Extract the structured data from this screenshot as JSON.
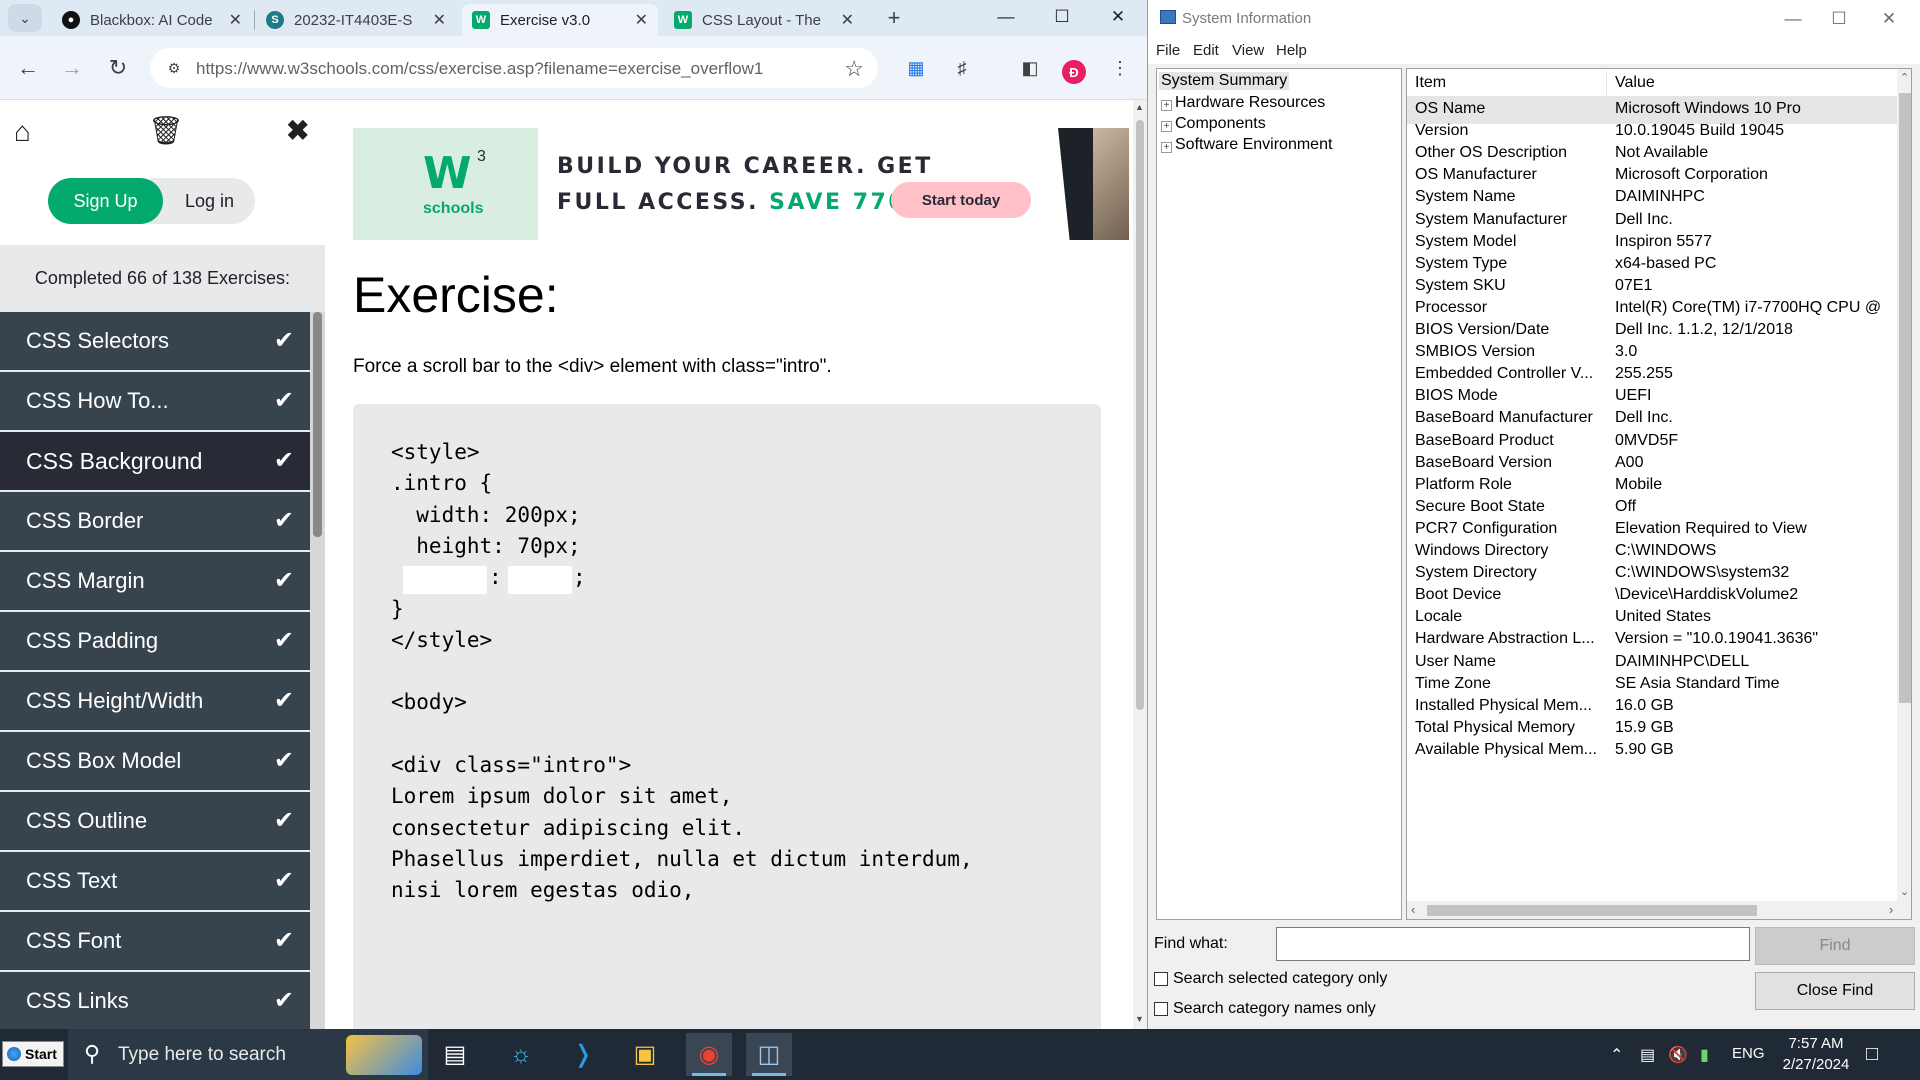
{
  "chrome": {
    "tabs": [
      {
        "title": "Blackbox: AI Code",
        "favicon": "blackbox-icon",
        "active": false
      },
      {
        "title": "20232-IT4403E-S",
        "favicon": "scribd-icon",
        "active": false
      },
      {
        "title": "Exercise v3.0",
        "favicon": "w3schools-icon",
        "active": true
      },
      {
        "title": "CSS Layout - The",
        "favicon": "w3schools-icon",
        "active": false
      }
    ],
    "url": "https://www.w3schools.com/css/exercise.asp?filename=exercise_overflow1",
    "profile_initial": "Đ"
  },
  "w3": {
    "signup_label": "Sign Up",
    "login_label": "Log in",
    "completed_text": "Completed 66 of 138 Exercises:",
    "exercises": [
      {
        "label": "CSS Selectors",
        "done": true
      },
      {
        "label": "CSS How To...",
        "done": true
      },
      {
        "label": "CSS Background",
        "done": true,
        "current": true
      },
      {
        "label": "CSS Border",
        "done": true
      },
      {
        "label": "CSS Margin",
        "done": true
      },
      {
        "label": "CSS Padding",
        "done": true
      },
      {
        "label": "CSS Height/Width",
        "done": true
      },
      {
        "label": "CSS Box Model",
        "done": true
      },
      {
        "label": "CSS Outline",
        "done": true
      },
      {
        "label": "CSS Text",
        "done": true
      },
      {
        "label": "CSS Font",
        "done": true
      },
      {
        "label": "CSS Links",
        "done": true
      }
    ],
    "ad": {
      "logo_text": "W",
      "logo_sup": "3",
      "logo_sub": "schools",
      "line1": "BUILD YOUR CAREER. GET",
      "line2_prefix": "FULL ACCESS. ",
      "line2_highlight": "SAVE 770$",
      "button": "Start today"
    },
    "title": "Exercise:",
    "description": "Force a scroll bar to the <div> element with class=\"intro\".",
    "code_lines": [
      "<style>",
      ".intro {",
      "  width: 200px;",
      "  height: 70px;",
      "__BLANKS__",
      "}",
      "</style>",
      "",
      "<body>",
      "",
      "<div class=\"intro\">",
      "Lorem ipsum dolor sit amet,",
      "consectetur adipiscing elit.",
      "Phasellus imperdiet, nulla et dictum interdum,",
      "nisi lorem egestas odio,"
    ],
    "blank_separator": ":",
    "blank_terminator": ";"
  },
  "sysinfo": {
    "title": "System Information",
    "menu": [
      "File",
      "Edit",
      "View",
      "Help"
    ],
    "tree": [
      "System Summary",
      "Hardware Resources",
      "Components",
      "Software Environment"
    ],
    "columns": [
      "Item",
      "Value"
    ],
    "rows": [
      [
        "OS Name",
        "Microsoft Windows 10 Pro"
      ],
      [
        "Version",
        "10.0.19045 Build 19045"
      ],
      [
        "Other OS Description",
        "Not Available"
      ],
      [
        "OS Manufacturer",
        "Microsoft Corporation"
      ],
      [
        "System Name",
        "DAIMINHPC"
      ],
      [
        "System Manufacturer",
        "Dell Inc."
      ],
      [
        "System Model",
        "Inspiron 5577"
      ],
      [
        "System Type",
        "x64-based PC"
      ],
      [
        "System SKU",
        "07E1"
      ],
      [
        "Processor",
        "Intel(R) Core(TM) i7-7700HQ CPU @"
      ],
      [
        "BIOS Version/Date",
        "Dell Inc. 1.1.2, 12/1/2018"
      ],
      [
        "SMBIOS Version",
        "3.0"
      ],
      [
        "Embedded Controller V...",
        "255.255"
      ],
      [
        "BIOS Mode",
        "UEFI"
      ],
      [
        "BaseBoard Manufacturer",
        "Dell Inc."
      ],
      [
        "BaseBoard Product",
        "0MVD5F"
      ],
      [
        "BaseBoard Version",
        "A00"
      ],
      [
        "Platform Role",
        "Mobile"
      ],
      [
        "Secure Boot State",
        "Off"
      ],
      [
        "PCR7 Configuration",
        "Elevation Required to View"
      ],
      [
        "Windows Directory",
        "C:\\WINDOWS"
      ],
      [
        "System Directory",
        "C:\\WINDOWS\\system32"
      ],
      [
        "Boot Device",
        "\\Device\\HarddiskVolume2"
      ],
      [
        "Locale",
        "United States"
      ],
      [
        "Hardware Abstraction L...",
        "Version = \"10.0.19041.3636\""
      ],
      [
        "User Name",
        "DAIMINHPC\\DELL"
      ],
      [
        "Time Zone",
        "SE Asia Standard Time"
      ],
      [
        "Installed Physical Mem...",
        "16.0 GB"
      ],
      [
        "Total Physical Memory",
        "15.9 GB"
      ],
      [
        "Available Physical Mem...",
        "5.90 GB"
      ]
    ],
    "find_label": "Find what:",
    "find_value": "",
    "find_button": "Find",
    "close_find_button": "Close Find",
    "opt_selected": "Search selected category only",
    "opt_names": "Search category names only"
  },
  "taskbar": {
    "start_label": "Start",
    "search_placeholder": "Type here to search",
    "language": "ENG",
    "time": "7:57 AM",
    "date": "2/27/2024"
  }
}
